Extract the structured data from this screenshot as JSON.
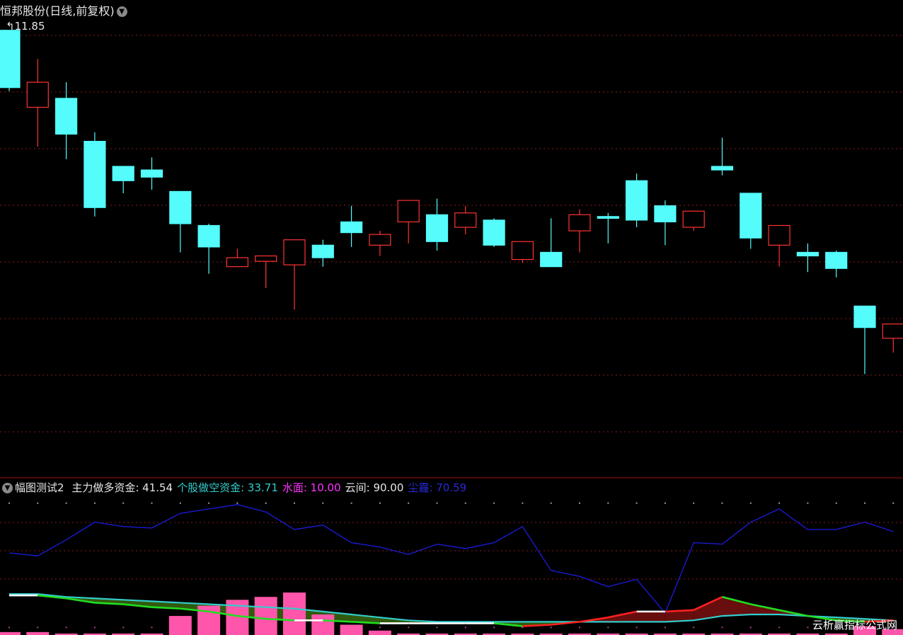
{
  "header": {
    "title": "恒邦股份(日线,前复权)",
    "max_price": "11.85"
  },
  "indicator": {
    "name": "幅图测试2",
    "items": [
      {
        "label": "主力做多资金:",
        "value": "41.54",
        "color": "#e6e6e6"
      },
      {
        "label": "个股做空资金:",
        "value": "33.71",
        "color": "#33cccc"
      },
      {
        "label": "水面:",
        "value": "10.00",
        "color": "#ff33ff"
      },
      {
        "label": "云间:",
        "value": "90.00",
        "color": "#e6e6e6"
      },
      {
        "label": "尘霾:",
        "value": "70.59",
        "color": "#2a2ad8"
      }
    ]
  },
  "watermark": "云析赢指标公式网",
  "colors": {
    "up": "#ff3333",
    "down": "#54fcfc",
    "grid": "#8b1a1a",
    "blue_line": "#1a1ad0",
    "cyan_line": "#33cccc",
    "volume": "#ff55aa",
    "fill_green": "#3a6a10",
    "fill_red": "#7a1010",
    "divider": "#a01010"
  },
  "chart_data": {
    "type": "candlestick",
    "title": "恒邦股份(日线,前复权)",
    "price_range": [
      9.4,
      11.93
    ],
    "candles": [
      {
        "o": 11.84,
        "h": 11.84,
        "l": 11.5,
        "c": 11.52
      },
      {
        "o": 11.41,
        "h": 11.68,
        "l": 11.19,
        "c": 11.55
      },
      {
        "o": 11.46,
        "h": 11.55,
        "l": 11.12,
        "c": 11.26
      },
      {
        "o": 11.22,
        "h": 11.27,
        "l": 10.8,
        "c": 10.85
      },
      {
        "o": 11.08,
        "h": 11.08,
        "l": 10.93,
        "c": 11.0
      },
      {
        "o": 11.06,
        "h": 11.13,
        "l": 10.95,
        "c": 11.02
      },
      {
        "o": 10.94,
        "h": 10.94,
        "l": 10.6,
        "c": 10.76
      },
      {
        "o": 10.75,
        "h": 10.76,
        "l": 10.48,
        "c": 10.63
      },
      {
        "o": 10.52,
        "h": 10.62,
        "l": 10.52,
        "c": 10.57
      },
      {
        "o": 10.55,
        "h": 10.58,
        "l": 10.4,
        "c": 10.58
      },
      {
        "o": 10.53,
        "h": 10.67,
        "l": 10.28,
        "c": 10.67
      },
      {
        "o": 10.64,
        "h": 10.67,
        "l": 10.52,
        "c": 10.57
      },
      {
        "o": 10.77,
        "h": 10.86,
        "l": 10.63,
        "c": 10.71
      },
      {
        "o": 10.64,
        "h": 10.72,
        "l": 10.58,
        "c": 10.7
      },
      {
        "o": 10.77,
        "h": 10.88,
        "l": 10.65,
        "c": 10.89
      },
      {
        "o": 10.81,
        "h": 10.9,
        "l": 10.61,
        "c": 10.66
      },
      {
        "o": 10.74,
        "h": 10.86,
        "l": 10.7,
        "c": 10.82
      },
      {
        "o": 10.78,
        "h": 10.79,
        "l": 10.63,
        "c": 10.64
      },
      {
        "o": 10.56,
        "h": 10.66,
        "l": 10.54,
        "c": 10.66
      },
      {
        "o": 10.6,
        "h": 10.79,
        "l": 10.52,
        "c": 10.52
      },
      {
        "o": 10.72,
        "h": 10.84,
        "l": 10.6,
        "c": 10.81
      },
      {
        "o": 10.8,
        "h": 10.82,
        "l": 10.65,
        "c": 10.79
      },
      {
        "o": 11.0,
        "h": 11.04,
        "l": 10.74,
        "c": 10.78
      },
      {
        "o": 10.86,
        "h": 10.89,
        "l": 10.64,
        "c": 10.77
      },
      {
        "o": 10.74,
        "h": 10.83,
        "l": 10.72,
        "c": 10.83
      },
      {
        "o": 11.08,
        "h": 11.24,
        "l": 11.03,
        "c": 11.06
      },
      {
        "o": 10.93,
        "h": 10.93,
        "l": 10.62,
        "c": 10.68
      },
      {
        "o": 10.64,
        "h": 10.75,
        "l": 10.52,
        "c": 10.75
      },
      {
        "o": 10.6,
        "h": 10.65,
        "l": 10.49,
        "c": 10.58
      },
      {
        "o": 10.6,
        "h": 10.61,
        "l": 10.46,
        "c": 10.51
      },
      {
        "o": 10.3,
        "h": 10.3,
        "l": 9.92,
        "c": 10.18
      },
      {
        "o": 10.12,
        "h": 10.2,
        "l": 10.04,
        "c": 10.2
      }
    ],
    "indicator_name": "幅图测试2",
    "indicator_range": [
      0,
      100
    ],
    "series": [
      {
        "name": "主力做多资金",
        "values": [
          27,
          27,
          25,
          22,
          21,
          19,
          18,
          16,
          13,
          11,
          10,
          10,
          9,
          8,
          8,
          8,
          8,
          8,
          6,
          7,
          9,
          12,
          16,
          16,
          17,
          26,
          21,
          17,
          13,
          10,
          9,
          10
        ]
      },
      {
        "name": "个股做空资金",
        "values": [
          28,
          28,
          26,
          25,
          24,
          23,
          22,
          21,
          20,
          19,
          18,
          16,
          14,
          12,
          10,
          9,
          9,
          9,
          9,
          9,
          9,
          9,
          9,
          9,
          10,
          13,
          14,
          14,
          13,
          12,
          11,
          10
        ]
      },
      {
        "name": "水面",
        "values": [
          10,
          10,
          10,
          10,
          10,
          10,
          10,
          10,
          10,
          10,
          10,
          10,
          10,
          10,
          10,
          10,
          10,
          10,
          10,
          10,
          10,
          10,
          10,
          10,
          10,
          10,
          10,
          10,
          10,
          10,
          10,
          10
        ]
      },
      {
        "name": "云间",
        "values": [
          90,
          90,
          90,
          90,
          90,
          90,
          90,
          90,
          90,
          90,
          90,
          90,
          90,
          90,
          90,
          90,
          90,
          90,
          90,
          90,
          90,
          90,
          90,
          90,
          90,
          90,
          90,
          90,
          90,
          90,
          90,
          90
        ]
      },
      {
        "name": "尘霾",
        "values": [
          56,
          54,
          65,
          77,
          74,
          73,
          83,
          86,
          89,
          84,
          72,
          75,
          63,
          60,
          55,
          62,
          59,
          63,
          74,
          44,
          40,
          33,
          38,
          15,
          63,
          62,
          77,
          86,
          72,
          72,
          77,
          70.59
        ]
      }
    ],
    "volume_bars": [
      2,
      2,
      1,
      1,
      1,
      1,
      13,
      20,
      24,
      26,
      29,
      14,
      7,
      3,
      1,
      1,
      1,
      1,
      1,
      1,
      1,
      1,
      1,
      1,
      1,
      1,
      1,
      1,
      1,
      1,
      6,
      4
    ]
  }
}
